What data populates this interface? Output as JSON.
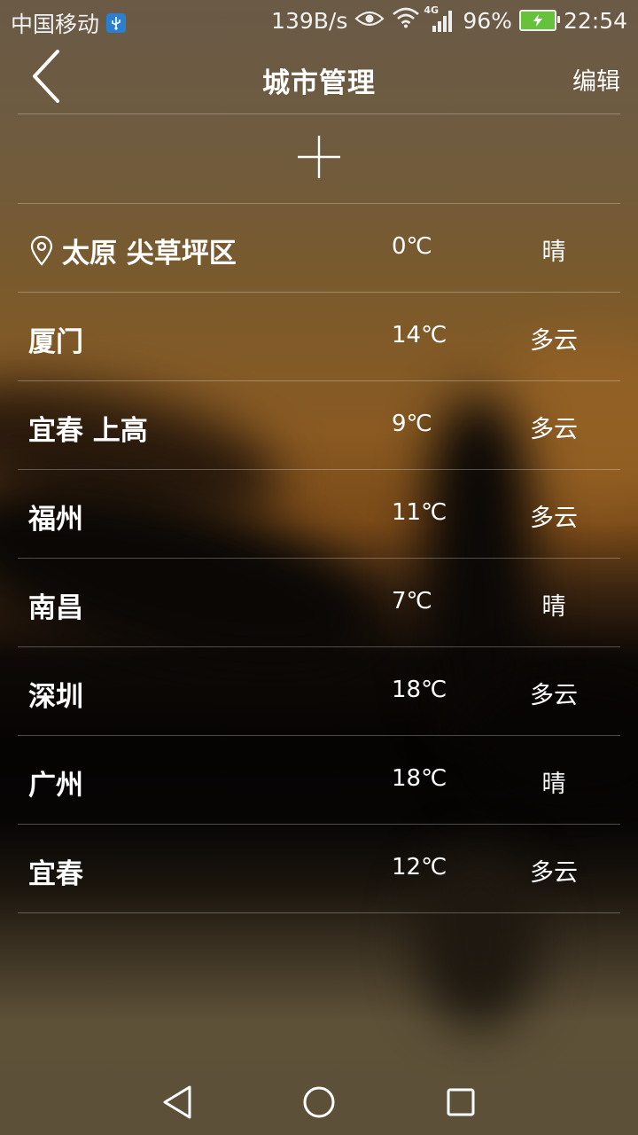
{
  "status_bar": {
    "carrier": "中国移动",
    "net_speed": "139B/s",
    "network_type": "4G",
    "battery_percent": "96%",
    "time": "22:54",
    "icons": [
      "usb-debug-icon",
      "eye-icon",
      "wifi-icon",
      "signal-icon",
      "battery-charging-icon"
    ]
  },
  "header": {
    "title": "城市管理",
    "edit_label": "编辑",
    "back_icon": "chevron-left-icon"
  },
  "add_button": {
    "icon": "plus-icon"
  },
  "cities": [
    {
      "name": "太原 尖草坪区",
      "temp": "0℃",
      "weather": "晴",
      "current_location": true
    },
    {
      "name": "厦门",
      "temp": "14℃",
      "weather": "多云"
    },
    {
      "name": "宜春 上高",
      "temp": "9℃",
      "weather": "多云"
    },
    {
      "name": "福州",
      "temp": "11℃",
      "weather": "多云"
    },
    {
      "name": "南昌",
      "temp": "7℃",
      "weather": "晴"
    },
    {
      "name": "深圳",
      "temp": "18℃",
      "weather": "多云"
    },
    {
      "name": "广州",
      "temp": "18℃",
      "weather": "晴"
    },
    {
      "name": "宜春",
      "temp": "12℃",
      "weather": "多云"
    }
  ],
  "nav_bar": {
    "icons": [
      "back-triangle-icon",
      "home-circle-icon",
      "recents-square-icon"
    ]
  }
}
